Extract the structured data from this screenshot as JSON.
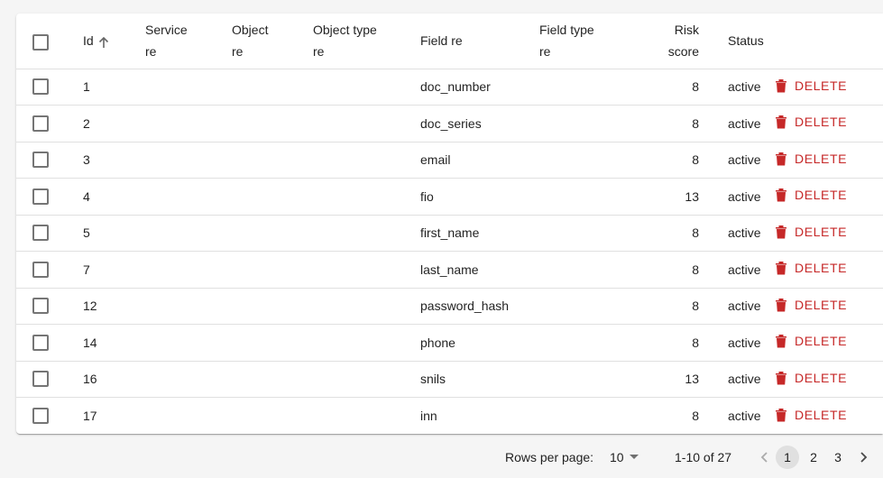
{
  "table": {
    "columns": {
      "id": "Id",
      "service_re": [
        "Service",
        "re"
      ],
      "object_re": [
        "Object",
        "re"
      ],
      "object_type_re": [
        "Object type",
        "re"
      ],
      "field_re": "Field re",
      "field_type_re": [
        "Field type",
        "re"
      ],
      "risk_score": [
        "Risk",
        "score"
      ],
      "status": "Status"
    },
    "sort_icon": "arrow-up-icon",
    "delete_label": "DELETE",
    "delete_icon": "trash-icon",
    "accent_color": "#c62828",
    "rows": [
      {
        "id": "1",
        "field": "doc_number",
        "risk": "8",
        "status": "active"
      },
      {
        "id": "2",
        "field": "doc_series",
        "risk": "8",
        "status": "active"
      },
      {
        "id": "3",
        "field": "email",
        "risk": "8",
        "status": "active"
      },
      {
        "id": "4",
        "field": "fio",
        "risk": "13",
        "status": "active"
      },
      {
        "id": "5",
        "field": "first_name",
        "risk": "8",
        "status": "active"
      },
      {
        "id": "7",
        "field": "last_name",
        "risk": "8",
        "status": "active"
      },
      {
        "id": "12",
        "field": "password_hash",
        "risk": "8",
        "status": "active"
      },
      {
        "id": "14",
        "field": "phone",
        "risk": "8",
        "status": "active"
      },
      {
        "id": "16",
        "field": "snils",
        "risk": "13",
        "status": "active"
      },
      {
        "id": "17",
        "field": "inn",
        "risk": "8",
        "status": "active"
      }
    ]
  },
  "pagination": {
    "rows_per_page_label": "Rows per page:",
    "rows_per_page_value": "10",
    "range": "1-10 of 27",
    "pages": [
      "1",
      "2",
      "3"
    ],
    "current_page": "1"
  }
}
